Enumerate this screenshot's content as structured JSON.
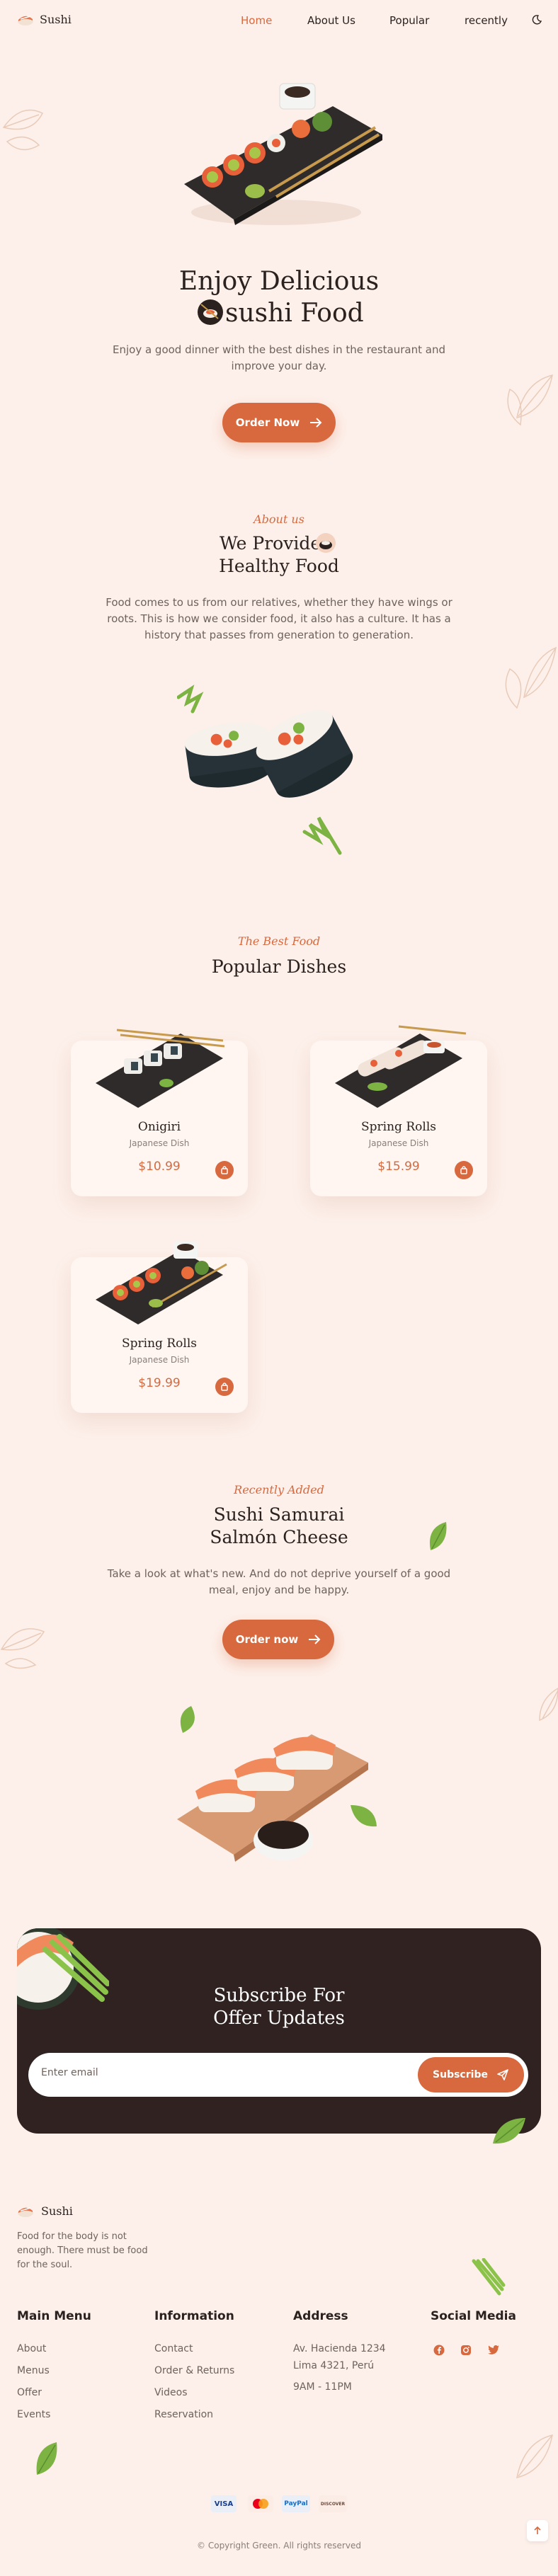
{
  "brand": {
    "name": "Sushi"
  },
  "nav": {
    "items": [
      "Home",
      "About Us",
      "Popular",
      "recently"
    ],
    "active": "Home"
  },
  "hero": {
    "title_line1": "Enjoy Delicious",
    "title_line2": "sushi Food",
    "description_line1": "Enjoy a good dinner with the best dishes in the restaurant and",
    "description_line2": "improve your day.",
    "button": "Order Now"
  },
  "about": {
    "subtitle": "About us",
    "title_line1": "We Provide",
    "title_line2": "Healthy Food",
    "text_line1": "Food comes to us from our relatives, whether they have wings or",
    "text_line2": "roots. This is how we consider food, it also has a culture. It has a",
    "text_line3": "history that passes from generation to generation."
  },
  "popular": {
    "subtitle": "The Best Food",
    "title": "Popular Dishes",
    "cards": [
      {
        "name": "Onigiri",
        "category": "Japanese Dish",
        "price": "$10.99"
      },
      {
        "name": "Spring Rolls",
        "category": "Japanese Dish",
        "price": "$15.99"
      },
      {
        "name": "Spring Rolls",
        "category": "Japanese Dish",
        "price": "$19.99"
      }
    ]
  },
  "recently": {
    "subtitle": "Recently Added",
    "title_line1": "Sushi Samurai",
    "title_line2": "Salmón Cheese",
    "text_line1": "Take a look at what's new. And do not deprive yourself of a good",
    "text_line2": "meal, enjoy and be happy.",
    "button": "Order now"
  },
  "subscribe": {
    "title_line1": "Subscribe For",
    "title_line2": "Offer Updates",
    "placeholder": "Enter email",
    "button": "Subscribe"
  },
  "footer": {
    "brand": "Sushi",
    "tagline_line1": "Food for the body is not",
    "tagline_line2": "enough. There must be food",
    "tagline_line3": "for the soul.",
    "main_menu": {
      "title": "Main Menu",
      "links": [
        "About",
        "Menus",
        "Offer",
        "Events"
      ]
    },
    "information": {
      "title": "Information",
      "links": [
        "Contact",
        "Order & Returns",
        "Videos",
        "Reservation"
      ]
    },
    "address": {
      "title": "Address",
      "line1": "Av. Hacienda 1234",
      "line2": "Lima 4321, Perú",
      "hours": "9AM - 11PM"
    },
    "social": {
      "title": "Social Media",
      "icons": [
        "facebook-icon",
        "instagram-icon",
        "twitter-icon"
      ]
    },
    "payments": [
      "VISA",
      "mastercard",
      "PayPal",
      "DISCOVER"
    ],
    "copyright": "© Copyright Green. All rights reserved"
  },
  "colors": {
    "accent": "#D8683D",
    "background": "#FDF0EA",
    "dark": "#2F2220",
    "text": "#2B211E"
  }
}
